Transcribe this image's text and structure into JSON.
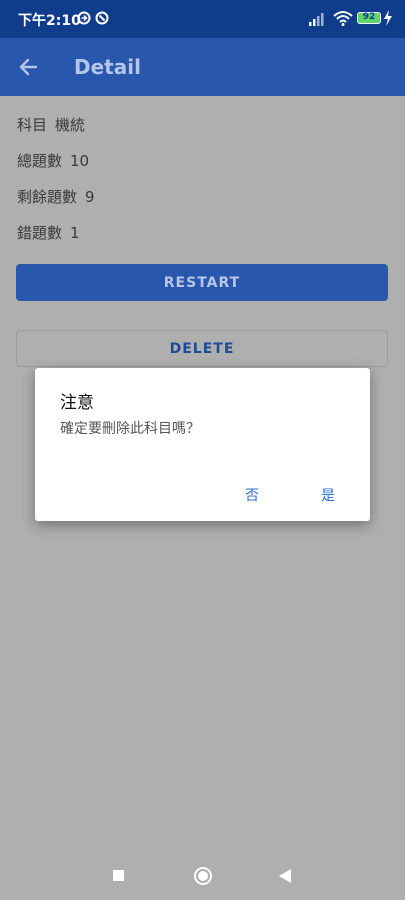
{
  "status_bar": {
    "time": "下午2:10",
    "battery": "92",
    "icons": [
      "notification-icon",
      "notification-icon",
      "signal-icon",
      "wifi-icon",
      "battery-icon",
      "charging-bolt-icon"
    ]
  },
  "app_bar": {
    "title": "Detail",
    "back_icon": "arrow-left-icon"
  },
  "details": {
    "subject_label": "科目",
    "subject_value": "機統",
    "total_label": "總題數",
    "total_value": "10",
    "remaining_label": "剩餘題數",
    "remaining_value": "9",
    "wrong_label": "錯題數",
    "wrong_value": "1"
  },
  "buttons": {
    "restart": "RESTART",
    "delete": "DELETE"
  },
  "dialog": {
    "title": "注意",
    "message": "確定要刪除此科目嗎？",
    "no": "否",
    "yes": "是"
  },
  "nav_bar": {
    "icons": [
      "recents-square-icon",
      "home-circle-icon",
      "back-triangle-icon"
    ]
  },
  "colors": {
    "status_bar": "#0f3d8c",
    "app_bar": "#2957ad",
    "scrim_background": "#afafaf",
    "dialog_action": "#2c6ed5"
  }
}
